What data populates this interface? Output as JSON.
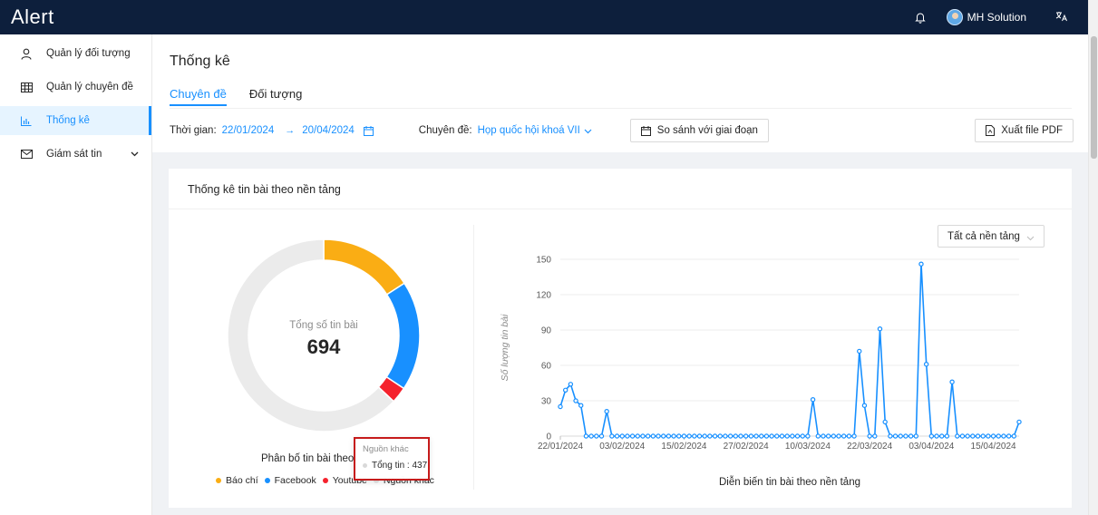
{
  "app": {
    "logo": "Alert",
    "user_name": "MH Solution",
    "language_icon": "translate-icon",
    "notification_icon": "bell-icon"
  },
  "sidebar": {
    "items": [
      {
        "label": "Quản lý đối tượng",
        "icon": "user-icon"
      },
      {
        "label": "Quản lý chuyên đề",
        "icon": "table-icon"
      },
      {
        "label": "Thống kê",
        "icon": "bar-chart-icon",
        "active": true
      },
      {
        "label": "Giám sát tin",
        "icon": "mail-icon",
        "expandable": true
      }
    ]
  },
  "page": {
    "title": "Thống kê",
    "tabs": [
      {
        "label": "Chuyên đề",
        "active": true
      },
      {
        "label": "Đối tượng"
      }
    ]
  },
  "filters": {
    "time_label": "Thời gian:",
    "date_from": "22/01/2024",
    "date_to": "20/04/2024",
    "topic_label": "Chuyên đề:",
    "topic_value": "Họp quốc hội khoá VII",
    "compare_button": "So sánh với giai đoạn",
    "export_button": "Xuất file PDF"
  },
  "stats": {
    "card_title": "Thống kê tin bài theo nền tảng",
    "platform_select": "Tất cả nền tảng",
    "total_label": "Tổng số tin bài",
    "total_value": "694",
    "pie_caption": "Phân bố tin bài theo",
    "tooltip": {
      "title": "Nguồn khác",
      "row": "Tổng tin : 437"
    },
    "legend": [
      {
        "label": "Báo chí",
        "color": "#faad14"
      },
      {
        "label": "Facebook",
        "color": "#1890ff"
      },
      {
        "label": "Youtube",
        "color": "#f5222d"
      },
      {
        "label": "Nguồn khác",
        "color": "#e8e8e8"
      }
    ],
    "line_xlabel": "Diễn biến tin bài theo nền tảng",
    "line_ylabel": "Số lượng tin bài"
  },
  "chart_data": [
    {
      "type": "pie",
      "title": "Phân bố tin bài theo nền tảng",
      "categories": [
        "Báo chí",
        "Facebook",
        "Youtube",
        "Nguồn khác"
      ],
      "values": [
        110,
        128,
        19,
        437
      ],
      "colors": [
        "#faad14",
        "#1890ff",
        "#f5222d",
        "#ebebeb"
      ],
      "legend": "bottom"
    },
    {
      "type": "line",
      "xlabel": "Diễn biến tin bài theo nền tảng",
      "ylabel": "Số lượng tin bài",
      "ylim": [
        0,
        150
      ],
      "yticks": [
        0,
        30,
        60,
        90,
        120,
        150
      ],
      "x_start": "22/01/2024",
      "x_end": "20/04/2024",
      "xtick_labels": [
        "22/01/2024",
        "03/02/2024",
        "15/02/2024",
        "27/02/2024",
        "10/03/2024",
        "22/03/2024",
        "03/04/2024",
        "15/04/2024"
      ],
      "grid": true,
      "series": [
        {
          "color": "#1890ff",
          "values": [
            25,
            39,
            44,
            30,
            26,
            0,
            0,
            0,
            0,
            21,
            0,
            0,
            0,
            0,
            0,
            0,
            0,
            0,
            0,
            0,
            0,
            0,
            0,
            0,
            0,
            0,
            0,
            0,
            0,
            0,
            0,
            0,
            0,
            0,
            0,
            0,
            0,
            0,
            0,
            0,
            0,
            0,
            0,
            0,
            0,
            0,
            0,
            0,
            0,
            31,
            0,
            0,
            0,
            0,
            0,
            0,
            0,
            0,
            72,
            26,
            0,
            0,
            91,
            12,
            0,
            0,
            0,
            0,
            0,
            0,
            146,
            61,
            0,
            0,
            0,
            0,
            46,
            0,
            0,
            0,
            0,
            0,
            0,
            0,
            0,
            0,
            0,
            0,
            0,
            12
          ]
        }
      ]
    }
  ]
}
